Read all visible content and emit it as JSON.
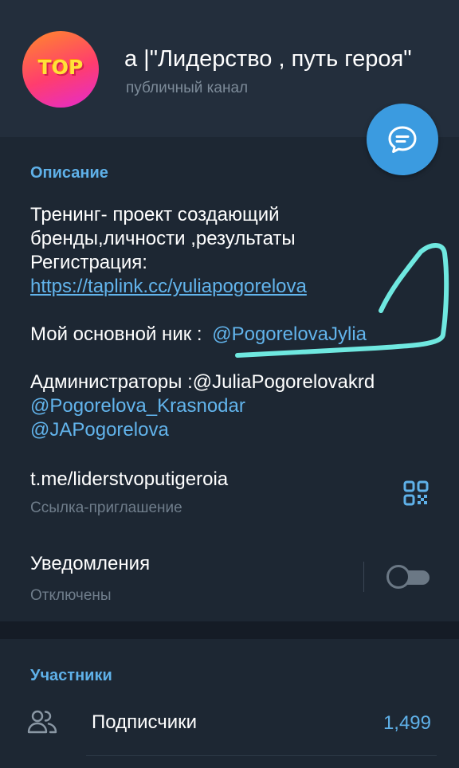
{
  "header": {
    "avatar_text": "TOP",
    "title": "а |\"Лидерство , путь героя\"",
    "subtitle": "публичный канал",
    "fab_icon": "chat-bubble-icon"
  },
  "description": {
    "header": "Описание",
    "line1": "Тренинг- проект создающий",
    "line2": "бренды,личности ,результаты",
    "line3": "Регистрация:",
    "link": "https://taplink.cc/yuliapogorelova",
    "nick_label": "Мой основной ник : ",
    "nick_value": "@PogorelovaJylia",
    "admins_label": "Администраторы :@JuliaPogorelovakrd",
    "admin2": "@Pogorelova_Krasnodar",
    "admin3": "@JAPogorelova"
  },
  "invite": {
    "link": "t.me/liderstvoputigeroia",
    "caption": "Ссылка-приглашение",
    "icon": "qr-code-icon"
  },
  "notifications": {
    "label": "Уведомления",
    "status": "Отключены",
    "enabled": false
  },
  "participants": {
    "header": "Участники",
    "subscribers_label": "Подписчики",
    "subscribers_count": "1,499",
    "icon": "people-icon"
  },
  "colors": {
    "background": "#1d2733",
    "header_bg": "#232e3c",
    "accent": "#5fb1e9",
    "fab": "#3b9be0",
    "annotation": "#6fe8e0"
  }
}
